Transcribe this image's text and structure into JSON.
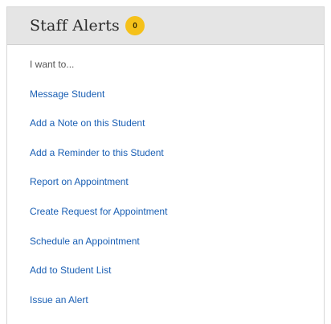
{
  "panel": {
    "title": "Staff Alerts",
    "badge_count": "0",
    "intro": "I want to...",
    "badge_color": "#f5c11a",
    "link_color": "#1a5fb4"
  },
  "actions": [
    {
      "label": "Message Student"
    },
    {
      "label": "Add a Note on this Student"
    },
    {
      "label": "Add a Reminder to this Student"
    },
    {
      "label": "Report on Appointment"
    },
    {
      "label": "Create Request for Appointment"
    },
    {
      "label": "Schedule an Appointment"
    },
    {
      "label": "Add to Student List"
    },
    {
      "label": "Issue an Alert"
    }
  ]
}
